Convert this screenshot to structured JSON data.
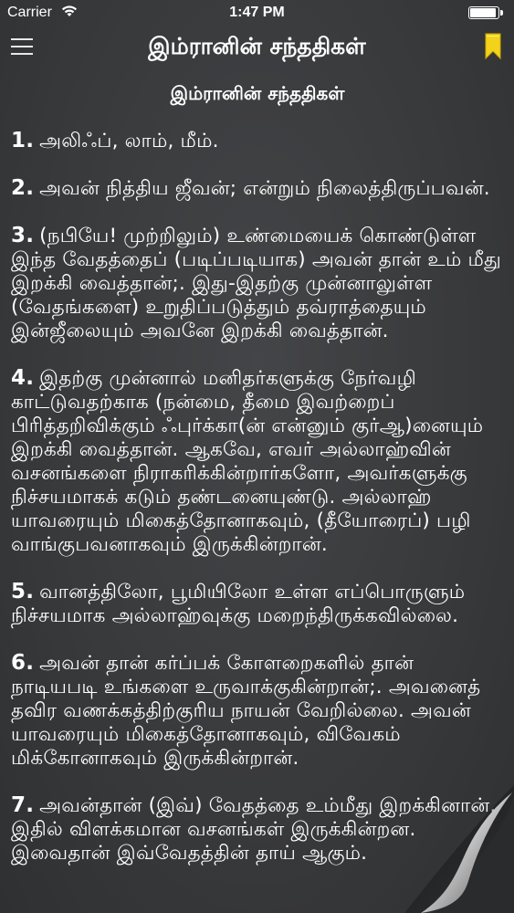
{
  "status": {
    "carrier": "Carrier",
    "time": "1:47 PM"
  },
  "nav": {
    "title": "இம்ரானின் சந்ததிகள்",
    "menu_icon": "hamburger-menu-icon",
    "bookmark_icon": "bookmark-icon",
    "bookmark_color": "#f2d21b"
  },
  "chapter": {
    "heading": "இம்ரானின் சந்ததிகள்"
  },
  "verses": [
    {
      "num": "1.",
      "text": "அலிஃப், லாம், மீம்."
    },
    {
      "num": "2.",
      "text": "அவன் நித்திய ஜீவன்; என்றும் நிலைத்திருப்பவன்."
    },
    {
      "num": "3.",
      "text": "(நபியே! முற்றிலும்) உண்மையைக் கொண்டுள்ள இந்த வேதத்தைப் (படிப்படியாக) அவன் தான் உம் மீது இறக்கி வைத்தான்;. இது-இதற்கு முன்னாலுள்ள (வேதங்களை) உறுதிப்படுத்தும் தவ்ராத்தையும் இன்ஜீலையும் அவனே இறக்கி வைத்தான்."
    },
    {
      "num": "4.",
      "text": "இதற்கு முன்னால் மனிதர்களுக்கு நேர்வழி காட்டுவதற்காக (நன்மை, தீமை இவற்றைப் பிரித்தறிவிக்கும் ஃபுர்க்கா(ன் என்னும் குர்ஆ)னையும் இறக்கி வைத்தான். ஆகவே, எவர் அல்லாஹ்வின் வசனங்களை நிராகரிக்கின்றார்களோ, அவர்களுக்கு நிச்சயமாகக் கடும் தண்டனையுண்டு. அல்லாஹ் யாவரையும் மிகைத்தோனாகவும், (தீயோரைப்) பழி வாங்குபவனாகவும் இருக்கின்றான்."
    },
    {
      "num": "5.",
      "text": "வானத்திலோ, பூமியிலோ உள்ள எப்பொருளும் நிச்சயமாக அல்லாஹ்வுக்கு மறைந்திருக்கவில்லை."
    },
    {
      "num": "6.",
      "text": "அவன் தான் கர்ப்பக் கோளறைகளில் தான் நாடியபடி உங்களை உருவாக்குகின்றான்;. அவனைத் தவிர வணக்கத்திற்குரிய நாயன் வேறில்லை. அவன் யாவரையும் மிகைத்தோனாகவும், விவேகம் மிக்கோனாகவும் இருக்கின்றான்."
    },
    {
      "num": "7.",
      "text": "அவன்தான் (இவ்) வேதத்தை உம்மீது இறக்கினான். இதில் விளக்கமான வசனங்கள் இருக்கின்றன. இவைதான் இவ்வேதத்தின் தாய் ஆகும்."
    }
  ]
}
